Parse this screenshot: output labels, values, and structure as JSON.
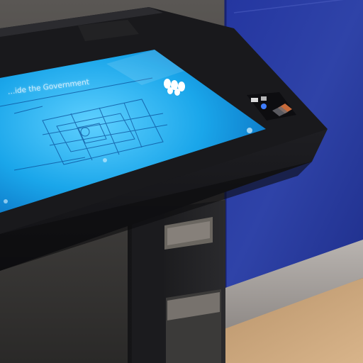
{
  "screen": {
    "title": "…ide the Government",
    "hint": "",
    "sub": ""
  },
  "colors": {
    "wall_blue": "#2d3fa3",
    "screen_cyan": "#19a9e8",
    "floor_wood": "#c9a67d",
    "table_body": "#1a1a1d"
  }
}
